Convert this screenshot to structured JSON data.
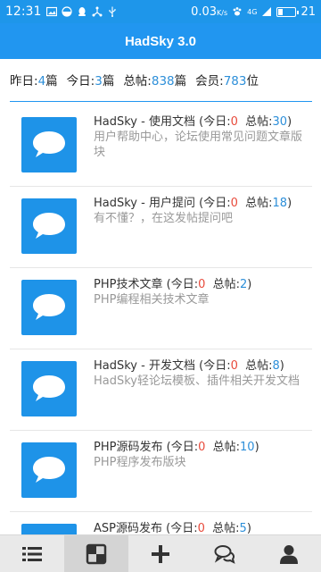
{
  "status_bar": {
    "time": "12:31",
    "speed": "0.03",
    "speed_unit": "K/s",
    "signal": "4G",
    "battery_level": "21",
    "battery_fraction": 0.21
  },
  "app_bar": {
    "title": "HadSky 3.0"
  },
  "stats": {
    "yesterday_label": "昨日:",
    "yesterday_value": "4",
    "yesterday_unit": "篇",
    "today_label": "今日:",
    "today_value": "3",
    "today_unit": "篇",
    "total_label": "总帖:",
    "total_value": "838",
    "total_unit": "篇",
    "members_label": "会员:",
    "members_value": "783",
    "members_unit": "位"
  },
  "forums": [
    {
      "name": "HadSky - 使用文档",
      "today_label": "今日:",
      "today": "0",
      "total_label": "总帖:",
      "total": "30",
      "desc": "用户帮助中心，论坛使用常见问题文章版块"
    },
    {
      "name": "HadSky - 用户提问",
      "today_label": "今日:",
      "today": "0",
      "total_label": "总帖:",
      "total": "18",
      "desc": "有不懂？，在这发帖提问吧"
    },
    {
      "name": "PHP技术文章",
      "today_label": "今日:",
      "today": "0",
      "total_label": "总帖:",
      "total": "2",
      "desc": "PHP编程相关技术文章"
    },
    {
      "name": "HadSky - 开发文档",
      "today_label": "今日:",
      "today": "0",
      "total_label": "总帖:",
      "total": "8",
      "desc": "HadSky轻论坛模板、插件相关开发文档"
    },
    {
      "name": "PHP源码发布",
      "today_label": "今日:",
      "today": "0",
      "total_label": "总帖:",
      "total": "10",
      "desc": "PHP程序发布版块"
    },
    {
      "name": "ASP源码发布",
      "today_label": "今日:",
      "today": "0",
      "total_label": "总帖:",
      "total": "5",
      "desc": ""
    }
  ],
  "bottom_nav": [
    {
      "icon": "list-icon",
      "active": false
    },
    {
      "icon": "board-icon",
      "active": true
    },
    {
      "icon": "plus-icon",
      "active": false
    },
    {
      "icon": "chat-icon",
      "active": false
    },
    {
      "icon": "user-icon",
      "active": false
    }
  ],
  "colors": {
    "primary": "#2196f0",
    "accent_red": "#e84b3c",
    "accent_blue": "#2d8fd9"
  }
}
